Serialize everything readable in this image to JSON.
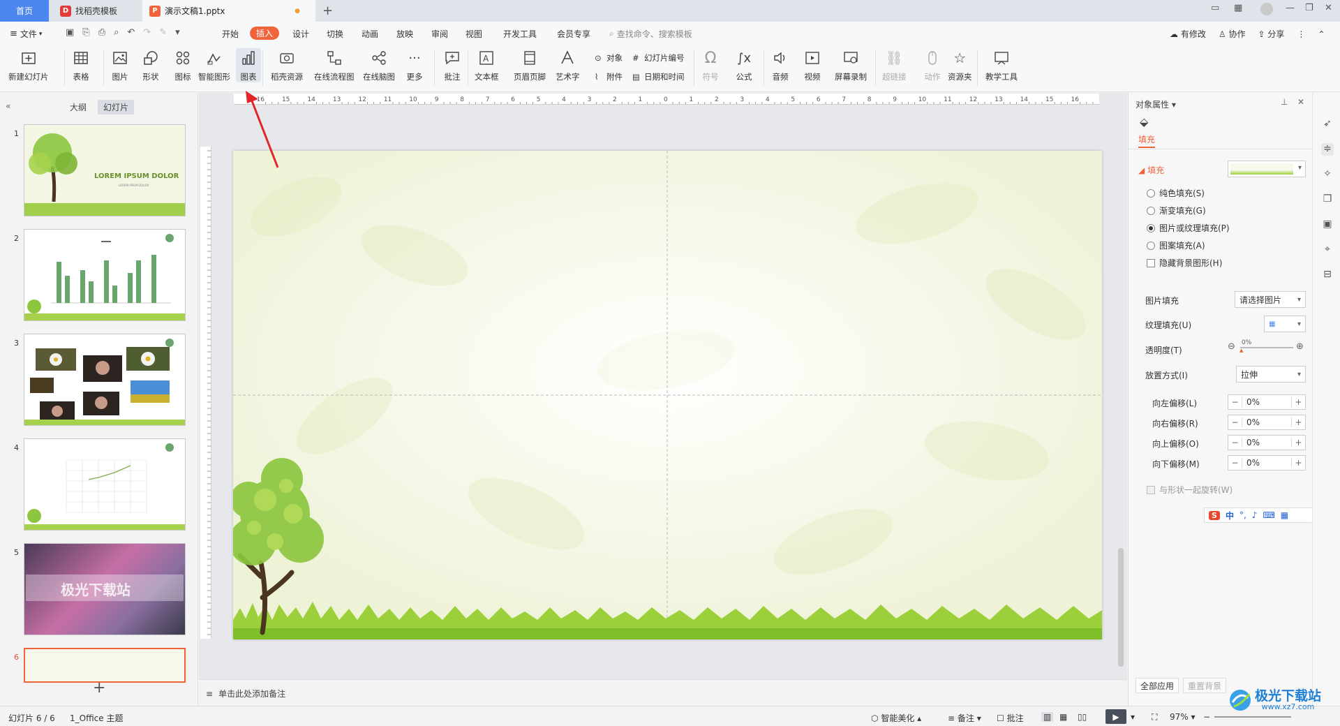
{
  "tabs": {
    "home": "首页",
    "template": "找稻壳模板",
    "document": "演示文稿1.pptx"
  },
  "menu": {
    "file": "文件",
    "tabs": [
      "开始",
      "插入",
      "设计",
      "切换",
      "动画",
      "放映",
      "审阅",
      "视图",
      "开发工具",
      "会员专享"
    ],
    "active_tab": "插入",
    "search_placeholder": "查找命令、搜索模板",
    "right": [
      "有修改",
      "协作",
      "分享"
    ]
  },
  "ribbon": {
    "new_slide": "新建幻灯片",
    "table": "表格",
    "picture": "图片",
    "shape": "形状",
    "icon": "图标",
    "smart_art": "智能图形",
    "chart": "图表",
    "docer_resource": "稻壳资源",
    "online_flowchart": "在线流程图",
    "online_mindmap": "在线脑图",
    "more": "更多",
    "comment": "批注",
    "textbox": "文本框",
    "header_footer": "页眉页脚",
    "wordart": "艺术字",
    "object": "对象",
    "slide_number": "幻灯片编号",
    "attachment": "附件",
    "datetime": "日期和时间",
    "symbol": "符号",
    "formula": "公式",
    "audio": "音频",
    "video": "视频",
    "screen_record": "屏幕录制",
    "hyperlink": "超链接",
    "action": "动作",
    "resource_folder": "资源夹",
    "teaching_tools": "教学工具"
  },
  "left_pane": {
    "tab_outline": "大纲",
    "tab_slides": "幻灯片",
    "slide_numbers": [
      "1",
      "2",
      "3",
      "4",
      "5",
      "6"
    ],
    "slide1_title": "LOREM IPSUM DOLOR",
    "slide1_subtitle": "LOREM IPSUM DOLOR",
    "slide5_text": "极光下载站",
    "add_slide": "+"
  },
  "notes": {
    "placeholder": "单击此处添加备注"
  },
  "ruler": {
    "h_ticks": [
      "16",
      "15",
      "14",
      "13",
      "12",
      "11",
      "10",
      "9",
      "8",
      "7",
      "6",
      "5",
      "4",
      "3",
      "2",
      "1",
      "0",
      "1",
      "2",
      "3",
      "4",
      "5",
      "6",
      "7",
      "8",
      "9",
      "10",
      "11",
      "12",
      "13",
      "14",
      "15",
      "16"
    ]
  },
  "right_pane": {
    "title": "对象属性",
    "fill_tab": "填充",
    "fill_section": "填充",
    "options": [
      "纯色填充(S)",
      "渐变填充(G)",
      "图片或纹理填充(P)",
      "图案填充(A)"
    ],
    "selected_option": "图片或纹理填充(P)",
    "hide_bg": "隐藏背景图形(H)",
    "picture_fill_label": "图片填充",
    "picture_fill_value": "请选择图片",
    "texture_fill_label": "纹理填充(U)",
    "transparency_label": "透明度(T)",
    "transparency_value": "0%",
    "placement_label": "放置方式(I)",
    "placement_value": "拉伸",
    "offsets": [
      {
        "label": "向左偏移(L)",
        "value": "0%"
      },
      {
        "label": "向右偏移(R)",
        "value": "0%"
      },
      {
        "label": "向上偏移(O)",
        "value": "0%"
      },
      {
        "label": "向下偏移(M)",
        "value": "0%"
      }
    ],
    "rotate_with_shape": "与形状一起旋转(W)",
    "apply_all": "全部应用",
    "reset_bg": "重置背景"
  },
  "ime": {
    "text": "中"
  },
  "status": {
    "slide_counter": "幻灯片 6 / 6",
    "theme": "1_Office 主题",
    "smart_beautify": "智能美化",
    "notes": "备注",
    "comments": "批注",
    "zoom": "97%"
  },
  "watermark": {
    "site": "极光下载站",
    "url": "www.xz7.com"
  },
  "colors": {
    "accent": "#f0643c",
    "home_tab": "#4e86f0",
    "arrow": "#e0262a"
  }
}
